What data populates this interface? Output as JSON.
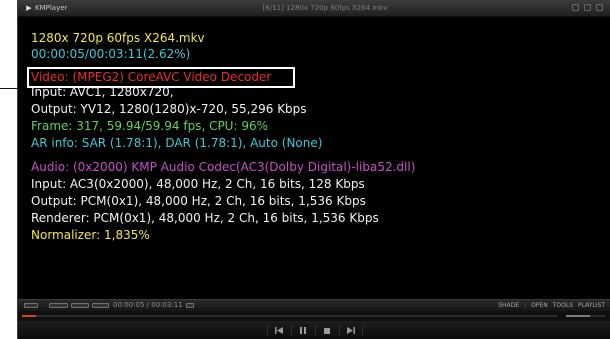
{
  "window": {
    "app_name": "KMPlayer",
    "title": "[6/11] 1280x 720p 60fps X264.mkv"
  },
  "osd": {
    "file_name": "1280x 720p 60fps X264.mkv",
    "position": "00:00:05/00:03:11(2.62%)",
    "video_decoder": "Video: (MPEG2) CoreAVC Video Decoder",
    "video_input": "Input: AVC1, 1280x720,",
    "video_output": "Output: YV12, 1280(1280)x-720, 55,296 Kbps",
    "frame": "Frame: 317, 59.94/59.94 fps, CPU: 96%",
    "ar_info": "AR info: SAR (1.78:1), DAR (1.78:1), Auto (None)",
    "audio_codec": "Audio: (0x2000) KMP Audio Codec(AC3(Dolby Digital)-liba52.dll)",
    "audio_input": "Input: AC3(0x2000), 48,000 Hz, 2 Ch, 16 bits, 128 Kbps",
    "audio_output": "Output: PCM(0x1), 48,000 Hz, 2 Ch, 16 bits, 1,536 Kbps",
    "renderer": "Renderer: PCM(0x1), 48,000 Hz, 2 Ch, 16 bits, 1,536 Kbps",
    "normalizer": "Normalizer: 1,835%"
  },
  "control_bar": {
    "time": "00:00:05 / 00:03:11",
    "menu": [
      "SHADE",
      "OPEN",
      "TOOLS",
      "PLAYLIST"
    ],
    "seek_progress_percent": 2.62,
    "volume_percent": 60
  },
  "transport": {
    "buttons": [
      "previous-icon",
      "pause-icon",
      "stop-icon",
      "next-icon"
    ]
  },
  "colors": {
    "yellow": "#f2e64a",
    "cyan": "#3ec8d6",
    "red": "#e8302a",
    "white": "#f2f2f2",
    "green": "#5fd35a",
    "purple": "#c84fc8",
    "seek_fill": "#d14a1c"
  }
}
